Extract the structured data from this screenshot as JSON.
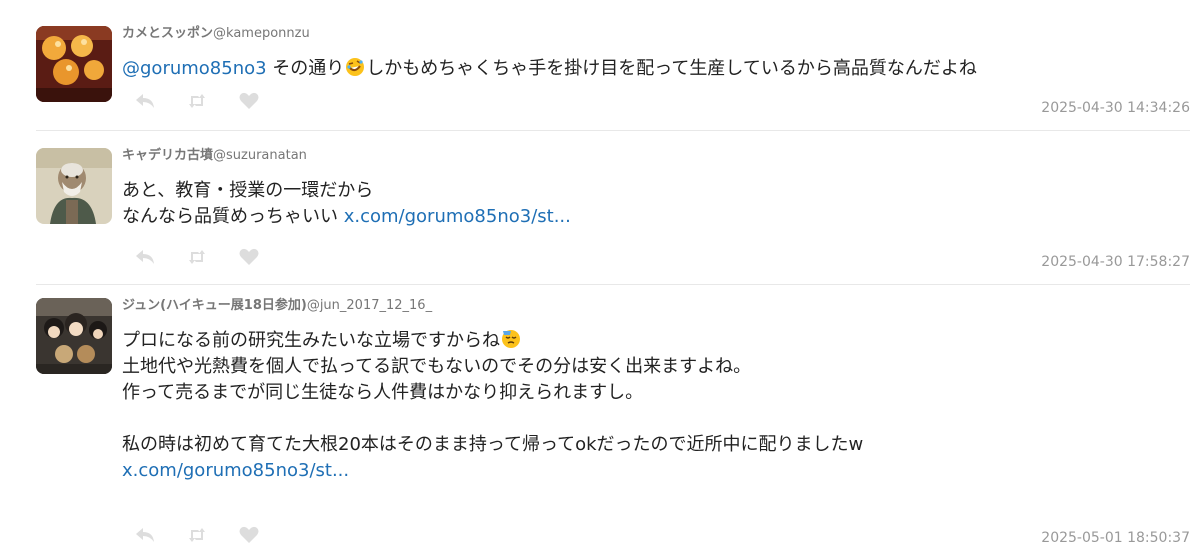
{
  "colors": {
    "link": "#1f6fb5",
    "meta_text": "#777777",
    "timestamp": "#999999",
    "action_icon": "#dddddd",
    "divider": "#e8e8e8"
  },
  "tweets": [
    {
      "display_name": "カメとスッポン",
      "handle": "@kameponnzu",
      "avatar_icon": "egg-yolks-photo",
      "lines": [
        {
          "mention": "@gorumo85no3",
          "text": " その通り",
          "emoji": "rofl-emoji",
          "text_after": "しかもめちゃくちゃ手を掛け目を配って生産しているから高品質なんだよね"
        }
      ],
      "timestamp": "2025-04-30 14:34:26"
    },
    {
      "display_name": "キャデリカ古墳",
      "handle": "@suzuranatan",
      "avatar_icon": "old-man-illustration",
      "lines": [
        {
          "text": "あと、教育・授業の一環だから"
        },
        {
          "text": "なんなら品質めっちゃいい ",
          "link": "x.com/gorumo85no3/st..."
        }
      ],
      "timestamp": "2025-04-30 17:58:27"
    },
    {
      "display_name": "ジュン(ハイキュー展18日参加)",
      "handle": "@jun_2017_12_16_",
      "avatar_icon": "figures-photo",
      "lines": [
        {
          "text": "プロになる前の研究生みたいな立場ですからね",
          "emoji": "relieved-sweat-emoji"
        },
        {
          "text": "土地代や光熱費を個人で払ってる訳でもないのでその分は安く出来ますよね。"
        },
        {
          "text": "作って売るまでが同じ生徒なら人件費はかなり抑えられますし。"
        },
        {
          "text": ""
        },
        {
          "text": "私の時は初めて育てた大根20本はそのまま持って帰ってokだったので近所中に配りましたw"
        },
        {
          "link": "x.com/gorumo85no3/st..."
        }
      ],
      "timestamp": "2025-05-01 18:50:37"
    }
  ]
}
